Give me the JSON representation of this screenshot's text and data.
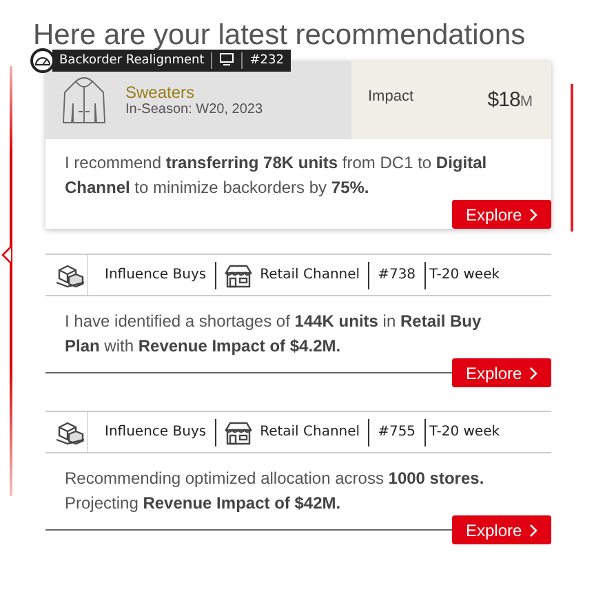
{
  "title": "Here are your latest recommendations",
  "featured": {
    "tag": "Backorder Realignment",
    "number": "#232",
    "product": "Sweaters",
    "season": "In-Season: W20, 2023",
    "impact_label": "Impact",
    "impact_value": "$18",
    "impact_unit": "M",
    "text": "I recommend **transferring 78K units** from DC1 to **Digital Channel** to minimize backorders by **75%.**",
    "button": "Explore"
  },
  "cards": [
    {
      "category": "Influence Buys",
      "channel": "Retail Channel",
      "number": "#738",
      "week": "T-20 week",
      "text": "I have identified a shortages of **144K units** in **Retail Buy Plan** with **Revenue Impact of $4.2M.**",
      "button": "Explore"
    },
    {
      "category": "Influence Buys",
      "channel": "Retail Channel",
      "number": "#755",
      "week": "T-20 week",
      "text": "Recommending optimized allocation across **1000 stores.** Projecting **Revenue Impact of $42M.**",
      "button": "Explore"
    }
  ]
}
